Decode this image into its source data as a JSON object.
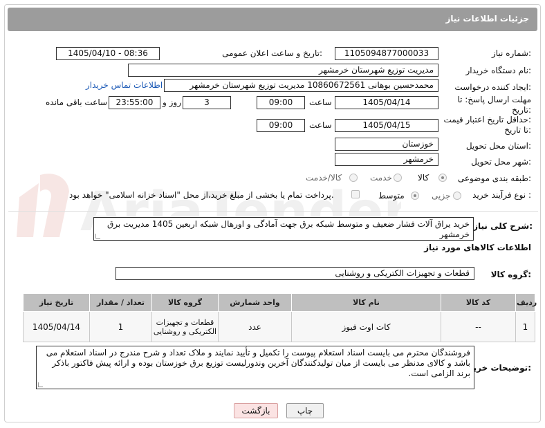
{
  "header": {
    "title": "جزئیات اطلاعات نیاز"
  },
  "need_number": {
    "label": "شماره نیاز:",
    "value": "1105094877000033"
  },
  "announce": {
    "label": "تاریخ و ساعت اعلان عمومی:",
    "value": "1405/04/10 - 08:36"
  },
  "buyer_org": {
    "label": "نام دستگاه خریدار:",
    "value": "مدیریت توزیع شهرستان خرمشهر"
  },
  "requester": {
    "label": "ایجاد کننده درخواست:",
    "value": "محمدحسین بوهانی 10860672561 مدیریت توزیع شهرستان خرمشهر",
    "contact_link": "اطلاعات تماس خریدار"
  },
  "deadline": {
    "label_line1": "مهلت ارسال پاسخ: تا",
    "label_line2": "تاریخ:",
    "date": "1405/04/14",
    "time_label": "ساعت",
    "time": "09:00",
    "days": "3",
    "days_label": "روز و",
    "remaining": "23:55:00",
    "remaining_label": "ساعت باقی مانده"
  },
  "price_validity": {
    "label_line1": "حداقل تاریخ اعتبار قیمت:",
    "label_line2": "تا تاریخ:",
    "date": "1405/04/15",
    "time_label": "ساعت",
    "time": "09:00"
  },
  "province": {
    "label": "استان محل تحویل:",
    "value": "خوزستان"
  },
  "city": {
    "label": "شهر محل تحویل:",
    "value": "خرمشهر"
  },
  "category": {
    "label": "طبقه بندی موضوعی:",
    "options": [
      "کالا",
      "خدمت",
      "کالا/خدمت"
    ],
    "selected": "کالا"
  },
  "purchase_type": {
    "label": "نوع فرآیند خرید :",
    "options": [
      "جزیی",
      "متوسط"
    ],
    "selected": "متوسط",
    "payment_note": "پرداخت تمام یا بخشی از مبلغ خرید،از محل \"اسناد خزانه اسلامی\" خواهد بود."
  },
  "description": {
    "label": "شرح کلی نیاز:",
    "value": "خرید یراق آلات فشار ضعیف و متوسط شبکه برق جهت آمادگی و اورهال شبکه اربعین 1405 مدیریت برق خرمشهر"
  },
  "goods_section": {
    "title": "اطلاعات کالاهای مورد نیاز"
  },
  "goods_group": {
    "label": "گروه کالا:",
    "value": "قطعات و تجهیزات الکتریکی و روشنایی"
  },
  "table": {
    "headers": [
      "ردیف",
      "کد کالا",
      "نام کالا",
      "واحد شمارش",
      "گروه کالا",
      "تعداد / مقدار",
      "تاریخ نیاز"
    ],
    "rows": [
      [
        "1",
        "--",
        "کات اوت فیوز",
        "عدد",
        "قطعات و تجهیزات الکتریکی و روشنایی",
        "1",
        "1405/04/14"
      ]
    ]
  },
  "buyer_notes": {
    "label": "توضیحات خریدار:",
    "value": "فروشندگان محترم می بایست اسناد استعلام پیوست را تکمیل و تأیید نمایند و ملاک تعداد و شرح مندرج در اسناد استعلام می باشد و کالای مدنظر می بایست از میان تولیدکنندگان آخرین وندورلیست توزیع برق خوزستان بوده و ارائه پیش فاکتور باذکر برند الزامی است."
  },
  "buttons": {
    "print": "چاپ",
    "back": "بازگشت"
  },
  "watermark": {
    "text": "AriaTender.net"
  },
  "colors": {
    "header_bg": "#9c9c9c",
    "link": "#1a58b5",
    "back_button": "#fbe3e3"
  }
}
